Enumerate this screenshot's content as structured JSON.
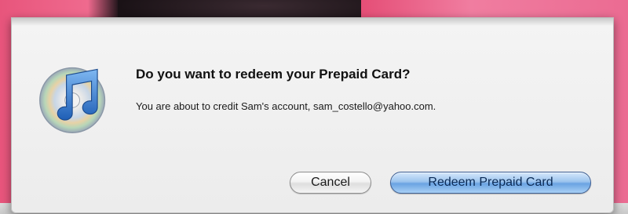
{
  "dialog": {
    "title": "Do you want to redeem your Prepaid Card?",
    "message": "You are about to credit Sam's account, sam_costello@yahoo.com.",
    "icon": "itunes-icon"
  },
  "buttons": {
    "cancel_label": "Cancel",
    "confirm_label": "Redeem Prepaid Card"
  },
  "colors": {
    "default_button": "#6aa3e2",
    "background_accent": "#e8557c"
  }
}
